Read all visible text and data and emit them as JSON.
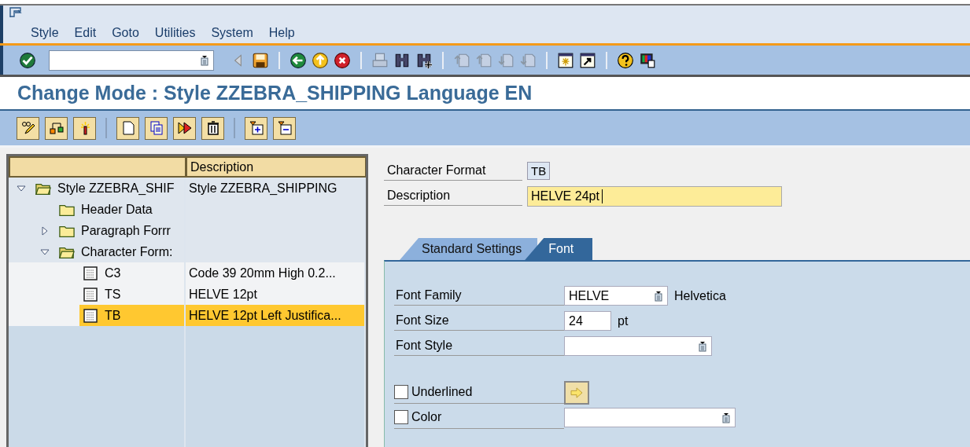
{
  "menu": [
    "Style",
    "Edit",
    "Goto",
    "Utilities",
    "System",
    "Help"
  ],
  "toolbar_groups": [
    [
      {
        "kind": "enter",
        "disabled": false
      }
    ],
    [
      {
        "kind": "back-arrow",
        "disabled": false
      },
      {
        "kind": "save",
        "disabled": false
      }
    ],
    [
      {
        "kind": "back",
        "disabled": false
      },
      {
        "kind": "exit",
        "disabled": false
      },
      {
        "kind": "cancel",
        "disabled": false
      }
    ],
    [
      {
        "kind": "print",
        "disabled": true
      },
      {
        "kind": "find",
        "disabled": false
      },
      {
        "kind": "find-next",
        "disabled": false
      }
    ],
    [
      {
        "kind": "first",
        "disabled": true
      },
      {
        "kind": "prev",
        "disabled": true
      },
      {
        "kind": "next",
        "disabled": true
      },
      {
        "kind": "last",
        "disabled": true
      }
    ],
    [
      {
        "kind": "new-window",
        "disabled": false
      },
      {
        "kind": "shortcut",
        "disabled": false
      }
    ],
    [
      {
        "kind": "help",
        "disabled": false
      },
      {
        "kind": "layout",
        "disabled": false
      }
    ]
  ],
  "title": "Change Mode : Style ZZEBRA_SHIPPING Language EN",
  "app_toolbar_groups": [
    [
      {
        "kind": "edit"
      },
      {
        "kind": "hierarchy"
      },
      {
        "kind": "wand"
      }
    ],
    [
      {
        "kind": "new"
      },
      {
        "kind": "copy"
      },
      {
        "kind": "compare"
      },
      {
        "kind": "delete"
      }
    ],
    [
      {
        "kind": "expand"
      },
      {
        "kind": "collapse"
      }
    ]
  ],
  "tree": {
    "columns": [
      "",
      "Description"
    ],
    "nodes": [
      {
        "kind": "folder",
        "name": "Style ZZEBRA_SHIF",
        "description": "Style ZZEBRA_SHIPPING",
        "expanded": true,
        "selected": false,
        "children": [
          {
            "kind": "folder",
            "name": "Header Data",
            "selected": false
          },
          {
            "kind": "folder",
            "name": "Paragraph Forrr",
            "expanded": false,
            "selected": false
          },
          {
            "kind": "folder",
            "name": "Character Form:",
            "expanded": true,
            "selected": false,
            "children": [
              {
                "kind": "format",
                "name": "C3",
                "description": "Code 39 20mm High 0.2...",
                "selected": false
              },
              {
                "kind": "format",
                "name": "TS",
                "description": "HELVE 12pt",
                "selected": false
              },
              {
                "kind": "format",
                "name": "TB",
                "description": "HELVE 12pt Left Justifica...",
                "selected": true
              }
            ]
          }
        ]
      }
    ]
  },
  "header_fields": [
    {
      "label": "Character Format",
      "value": "TB",
      "kind": "display"
    },
    {
      "label": "Description",
      "value": "HELVE 24pt",
      "kind": "input"
    }
  ],
  "tabs": [
    {
      "label": "Standard Settings",
      "selected": false
    },
    {
      "label": "Font",
      "selected": true
    }
  ],
  "font_fields": [
    {
      "label": "Font Family",
      "value": "HELVE",
      "kind": "dropdown",
      "note": "Helvetica"
    },
    {
      "label": "Font Size",
      "value": "24",
      "kind": "short",
      "note": "pt"
    },
    {
      "label": "Font Style",
      "kind": "dropdown"
    }
  ],
  "options": [
    {
      "label": "Underlined",
      "checked": false,
      "kind": "button"
    },
    {
      "label": "Color",
      "checked": false,
      "kind": "dropdown"
    }
  ]
}
